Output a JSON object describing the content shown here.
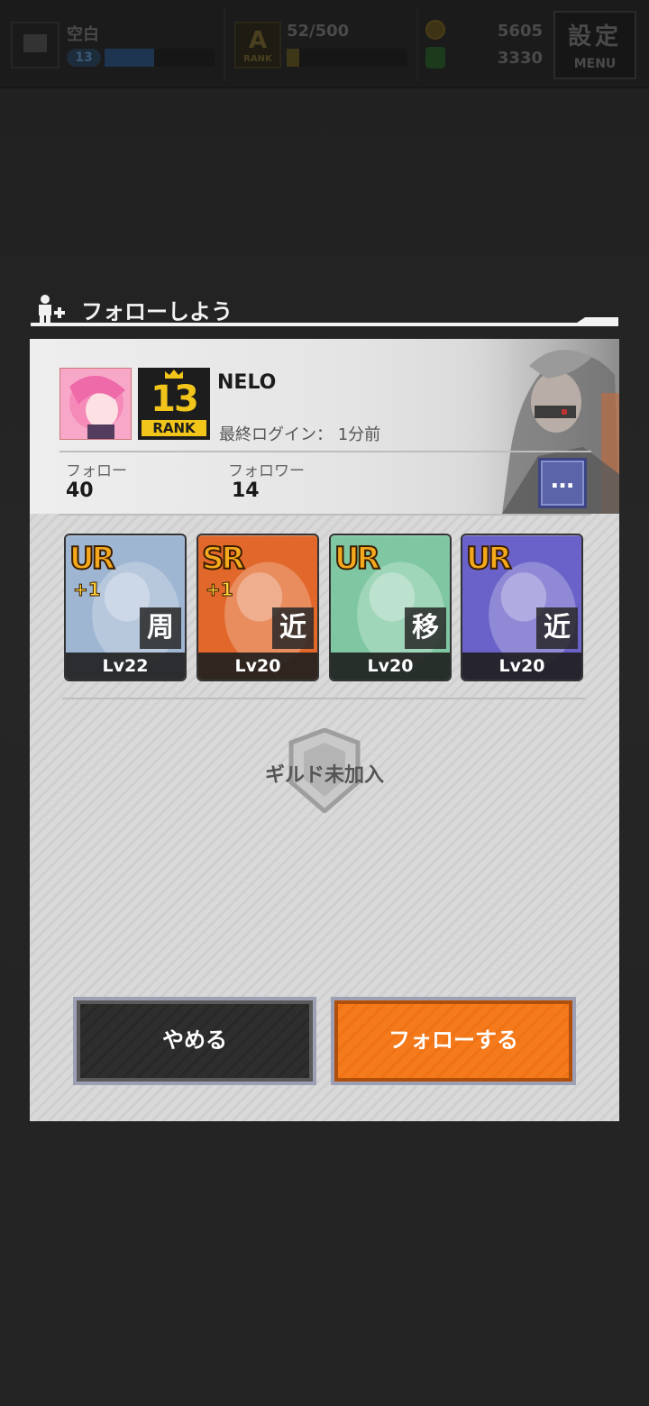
{
  "topbar": {
    "status_text": "空白",
    "player_level": "13",
    "exp_fraction": 0.45,
    "rank_letter": "A",
    "rank_label": "RANK",
    "stamina": "52/500",
    "stamina_fraction": 0.104,
    "coins": "5605",
    "gems": "3330",
    "menu_kanji": "設定",
    "menu_label": "MENU"
  },
  "dialog": {
    "title": "フォローしよう",
    "player": {
      "name": "NELO",
      "rank_number": "13",
      "rank_label": "RANK",
      "last_login": "最終ログイン： 1分前",
      "follow_label": "フォロー",
      "follow_count": "40",
      "follower_label": "フォロワー",
      "follower_count": "14",
      "more_label": "…"
    },
    "cards": [
      {
        "rarity": "UR",
        "plus": "+1",
        "type": "周",
        "level": "Lv22",
        "color": "#9fb6d2"
      },
      {
        "rarity": "SR",
        "plus": "+1",
        "type": "近",
        "level": "Lv20",
        "color": "#e2672a"
      },
      {
        "rarity": "UR",
        "plus": "",
        "type": "移",
        "level": "Lv20",
        "color": "#7fc7a2"
      },
      {
        "rarity": "UR",
        "plus": "",
        "type": "近",
        "level": "Lv20",
        "color": "#6a62c8"
      }
    ],
    "guild_status": "ギルド未加入",
    "cancel_label": "やめる",
    "follow_label": "フォローする"
  },
  "colors": {
    "follow_button": "#f47a1b",
    "cancel_button": "#2e2e2e",
    "rank_gold": "#f2c51a",
    "more_button": "#5b64a8"
  },
  "icons": [
    "tv-icon",
    "coin-icon",
    "gem-icon",
    "add-person-icon",
    "guild-shield-icon"
  ]
}
